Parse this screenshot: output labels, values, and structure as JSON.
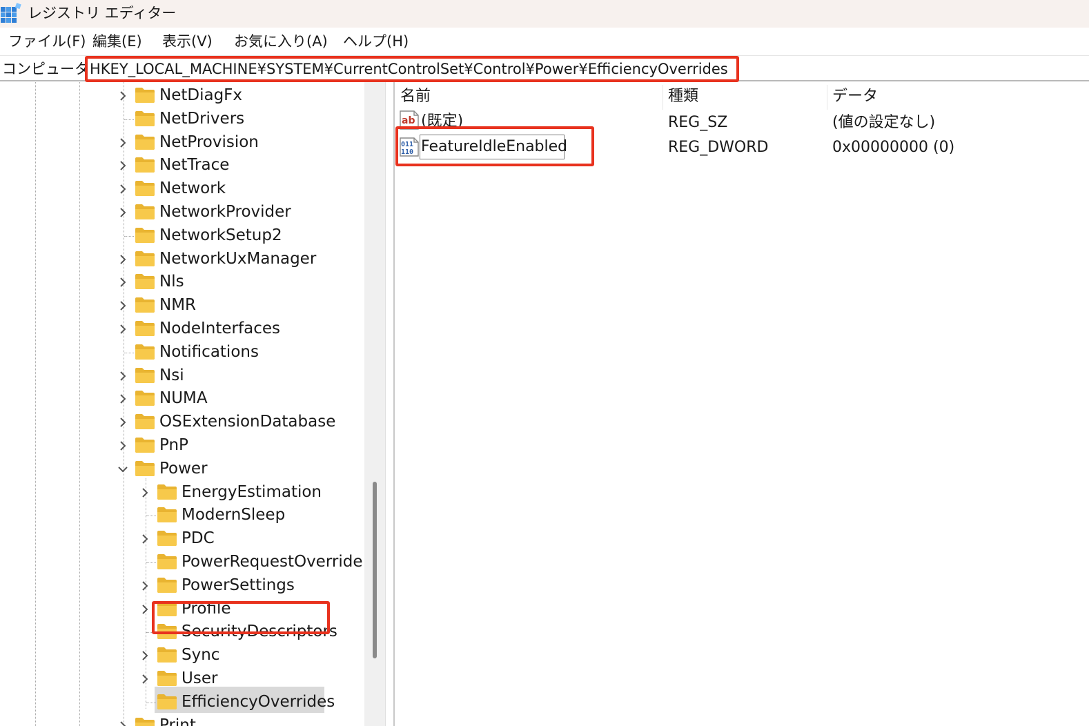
{
  "window": {
    "title": "レジストリ エディター"
  },
  "menu": {
    "items": [
      "ファイル(F)",
      "編集(E)",
      "表示(V)",
      "お気に入り(A)",
      "ヘルプ(H)"
    ]
  },
  "address": {
    "prefix": "コンピューター¥",
    "path": "HKEY_LOCAL_MACHINE¥SYSTEM¥CurrentControlSet¥Control¥Power¥EfficiencyOverrides"
  },
  "tree": {
    "nodes": [
      {
        "label": "NetDiagFx",
        "level": 0,
        "expander": "collapsed"
      },
      {
        "label": "NetDrivers",
        "level": 0,
        "expander": "none"
      },
      {
        "label": "NetProvision",
        "level": 0,
        "expander": "collapsed"
      },
      {
        "label": "NetTrace",
        "level": 0,
        "expander": "collapsed"
      },
      {
        "label": "Network",
        "level": 0,
        "expander": "collapsed"
      },
      {
        "label": "NetworkProvider",
        "level": 0,
        "expander": "collapsed"
      },
      {
        "label": "NetworkSetup2",
        "level": 0,
        "expander": "none"
      },
      {
        "label": "NetworkUxManager",
        "level": 0,
        "expander": "collapsed"
      },
      {
        "label": "Nls",
        "level": 0,
        "expander": "collapsed"
      },
      {
        "label": "NMR",
        "level": 0,
        "expander": "collapsed"
      },
      {
        "label": "NodeInterfaces",
        "level": 0,
        "expander": "collapsed"
      },
      {
        "label": "Notifications",
        "level": 0,
        "expander": "none"
      },
      {
        "label": "Nsi",
        "level": 0,
        "expander": "collapsed"
      },
      {
        "label": "NUMA",
        "level": 0,
        "expander": "collapsed"
      },
      {
        "label": "OSExtensionDatabase",
        "level": 0,
        "expander": "collapsed"
      },
      {
        "label": "PnP",
        "level": 0,
        "expander": "collapsed"
      },
      {
        "label": "Power",
        "level": 0,
        "expander": "expanded"
      },
      {
        "label": "EnergyEstimation",
        "level": 1,
        "expander": "collapsed"
      },
      {
        "label": "ModernSleep",
        "level": 1,
        "expander": "none"
      },
      {
        "label": "PDC",
        "level": 1,
        "expander": "collapsed"
      },
      {
        "label": "PowerRequestOverride",
        "level": 1,
        "expander": "none"
      },
      {
        "label": "PowerSettings",
        "level": 1,
        "expander": "collapsed"
      },
      {
        "label": "Profile",
        "level": 1,
        "expander": "collapsed"
      },
      {
        "label": "SecurityDescriptors",
        "level": 1,
        "expander": "none"
      },
      {
        "label": "Sync",
        "level": 1,
        "expander": "collapsed"
      },
      {
        "label": "User",
        "level": 1,
        "expander": "collapsed"
      },
      {
        "label": "EfficiencyOverrides",
        "level": 1,
        "expander": "none",
        "selected": true
      },
      {
        "label": "Print",
        "level": 0,
        "expander": "collapsed"
      }
    ]
  },
  "list": {
    "columns": [
      "名前",
      "種類",
      "データ"
    ],
    "rows": [
      {
        "icon": "string-value-icon",
        "name": "(既定)",
        "type": "REG_SZ",
        "data": "(値の設定なし)"
      },
      {
        "icon": "binary-value-icon",
        "name": "FeatureIdleEnabled",
        "type": "REG_DWORD",
        "data": "0x00000000 (0)",
        "editing": true
      }
    ]
  },
  "colors": {
    "highlight": "#e8321e",
    "folder": "#f7c94b",
    "titlebar": "#f7f1ee",
    "selection": "#d9d9d9"
  }
}
